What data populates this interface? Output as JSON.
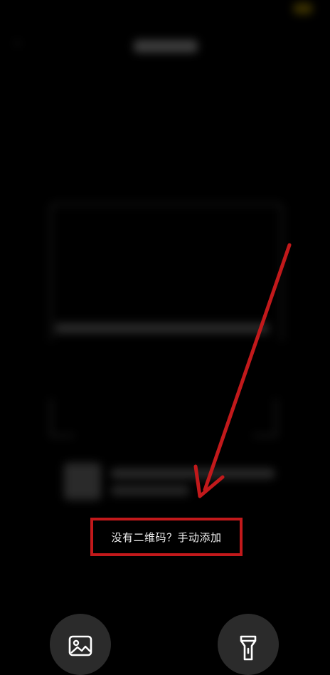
{
  "scan": {
    "manual_add_label": "没有二维码？手动添加"
  },
  "icons": {
    "gallery": "image-icon",
    "flashlight": "flashlight-icon",
    "back": "back-arrow-icon"
  },
  "colors": {
    "background": "#000000",
    "annotation_red": "#c2191b",
    "button_bg": "#2b2b2b"
  }
}
